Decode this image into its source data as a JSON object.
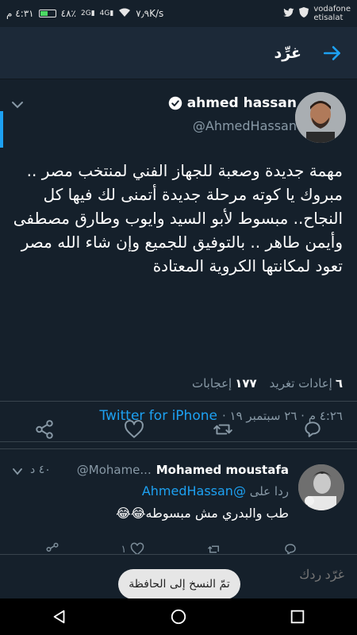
{
  "status_bar": {
    "time": "٤:٣١ م",
    "battery": "٤٨٪",
    "signal_label": "2G",
    "signal2_label": "4G",
    "speed": "٧٫٩K/s",
    "carrier_line1": "vodafone",
    "carrier_line2": "etisalat",
    "battery_level_percent": 48
  },
  "header": {
    "title": "غرِّد"
  },
  "tweet": {
    "author_name": "ahmed hassan",
    "handle": "@AhmedHassan",
    "verified": true,
    "text": "مهمة جديدة وصعبة للجهاز الفني لمنتخب مصر .. مبروك يا كوته مرحلة جديدة أتمنى لك فيها كل النجاح.. مبسوط لأبو السيد وايوب وطارق مصطفى وأيمن طاهر .. بالتوفيق للجميع وإن شاء الله مصر تعود لمكانتها الكروية المعتادة",
    "timestamp": "٤:٢٦ م · ٢٦ سبتمبر ١٩ ·",
    "source": "Twitter for iPhone",
    "retweets_count": "٦",
    "retweets_label": "إعادات تغريد",
    "likes_count": "١٧٧",
    "likes_label": "إعجابات"
  },
  "reply": {
    "name": "Mohamed moustafa",
    "handle": "@Mohame...",
    "time": "٤٠ د",
    "replying_to_label": "ردا على",
    "replying_to_handle": "@AhmedHassan",
    "text": "طب والبدري مش مبسوطه😂😂",
    "like_count": "١"
  },
  "compose": {
    "placeholder": "غرّد ردك"
  },
  "toast": {
    "text": "تمّ النسخ إلى الحافظة"
  },
  "colors": {
    "background": "#15202b",
    "header": "#1c2938",
    "accent": "#1da1f2",
    "muted": "#8899a6"
  }
}
